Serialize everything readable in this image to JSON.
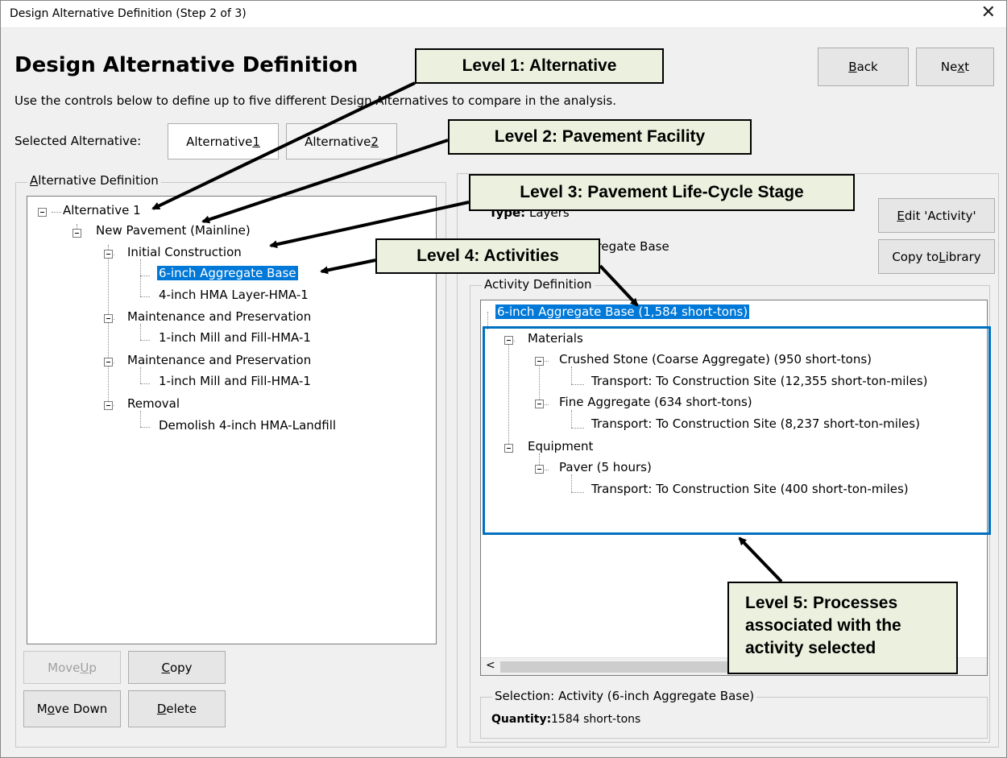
{
  "window": {
    "title": "Design Alternative Definition (Step 2 of 3)",
    "close_glyph": "✕"
  },
  "heading": "Design Alternative Definition",
  "description": "Use the controls below to define up to five different Design Alternatives to compare in the analysis.",
  "nav": {
    "back_pre": "",
    "back_u": "B",
    "back_post": "ack",
    "next_pre": "Ne",
    "next_u": "x",
    "next_post": "t"
  },
  "selected_alternative": {
    "label": "Selected Alternative:",
    "tabs": [
      {
        "pre": "Alternative ",
        "u": "1",
        "selected": true
      },
      {
        "pre": "Alternative ",
        "u": "2",
        "selected": false
      }
    ]
  },
  "alt_definition": {
    "label_u": "A",
    "label_rest": "lternative Definition",
    "tree": [
      {
        "label": "Alternative 1",
        "expanded": true
      },
      {
        "label": "New Pavement (Mainline)",
        "expanded": true
      },
      {
        "label": "Initial Construction",
        "expanded": true
      },
      {
        "label": "6-inch Aggregate Base",
        "selected": true
      },
      {
        "label": "4-inch HMA Layer-HMA-1"
      },
      {
        "label": "Maintenance and Preservation",
        "expanded": true
      },
      {
        "label": "1-inch Mill and Fill-HMA-1"
      },
      {
        "label": "Maintenance and Preservation",
        "expanded": true
      },
      {
        "label": "1-inch Mill and Fill-HMA-1"
      },
      {
        "label": "Removal",
        "expanded": true
      },
      {
        "label": "Demolish 4-inch HMA-Landfill"
      }
    ],
    "buttons": {
      "move_up_pre": "Move ",
      "move_up_u": "U",
      "move_up_post": "p",
      "copy_u": "C",
      "copy_post": "opy",
      "move_down_pre": "M",
      "move_down_u": "o",
      "move_down_post": "ve Down",
      "delete_u": "D",
      "delete_post": "elete"
    }
  },
  "right_panel": {
    "type_label": "Type:",
    "type_value": "Layers",
    "name_partial": "gregate Base",
    "edit_pre": "",
    "edit_u": "E",
    "edit_post": "dit 'Activity'",
    "copy_lib_pre": "Copy to ",
    "copy_lib_u": "L",
    "copy_lib_post": "ibrary",
    "activity_definition_label": "Activity Definition",
    "activity_tree": [
      {
        "label": "6-inch Aggregate Base (1,584 short-tons)",
        "selected": true
      },
      {
        "label": "Materials",
        "expanded": true
      },
      {
        "label": "Crushed Stone (Coarse Aggregate) (950 short-tons)",
        "expanded": true
      },
      {
        "label": "Transport: To Construction Site (12,355 short-ton-miles)"
      },
      {
        "label": "Fine Aggregate (634 short-tons)",
        "expanded": true
      },
      {
        "label": "Transport: To Construction Site (8,237 short-ton-miles)"
      },
      {
        "label": "Equipment",
        "expanded": true
      },
      {
        "label": "Paver (5 hours)",
        "expanded": true
      },
      {
        "label": "Transport: To Construction Site (400 short-ton-miles)"
      }
    ],
    "scroll_left_glyph": "<",
    "selection_label": "Selection: Activity (6-inch Aggregate Base)",
    "quantity_label": "Quantity:",
    "quantity_value": "1584 short-tons"
  },
  "callouts": {
    "level1": "Level 1: Alternative",
    "level2": "Level 2: Pavement Facility",
    "level3": "Level 3: Pavement Life-Cycle Stage",
    "level4": "Level 4: Activities",
    "level5": "Level 5: Processes associated with the activity selected"
  },
  "colors": {
    "selection": "#0078d7",
    "callout_fill": "#ebf1de",
    "highlight_box": "#0070c0"
  }
}
